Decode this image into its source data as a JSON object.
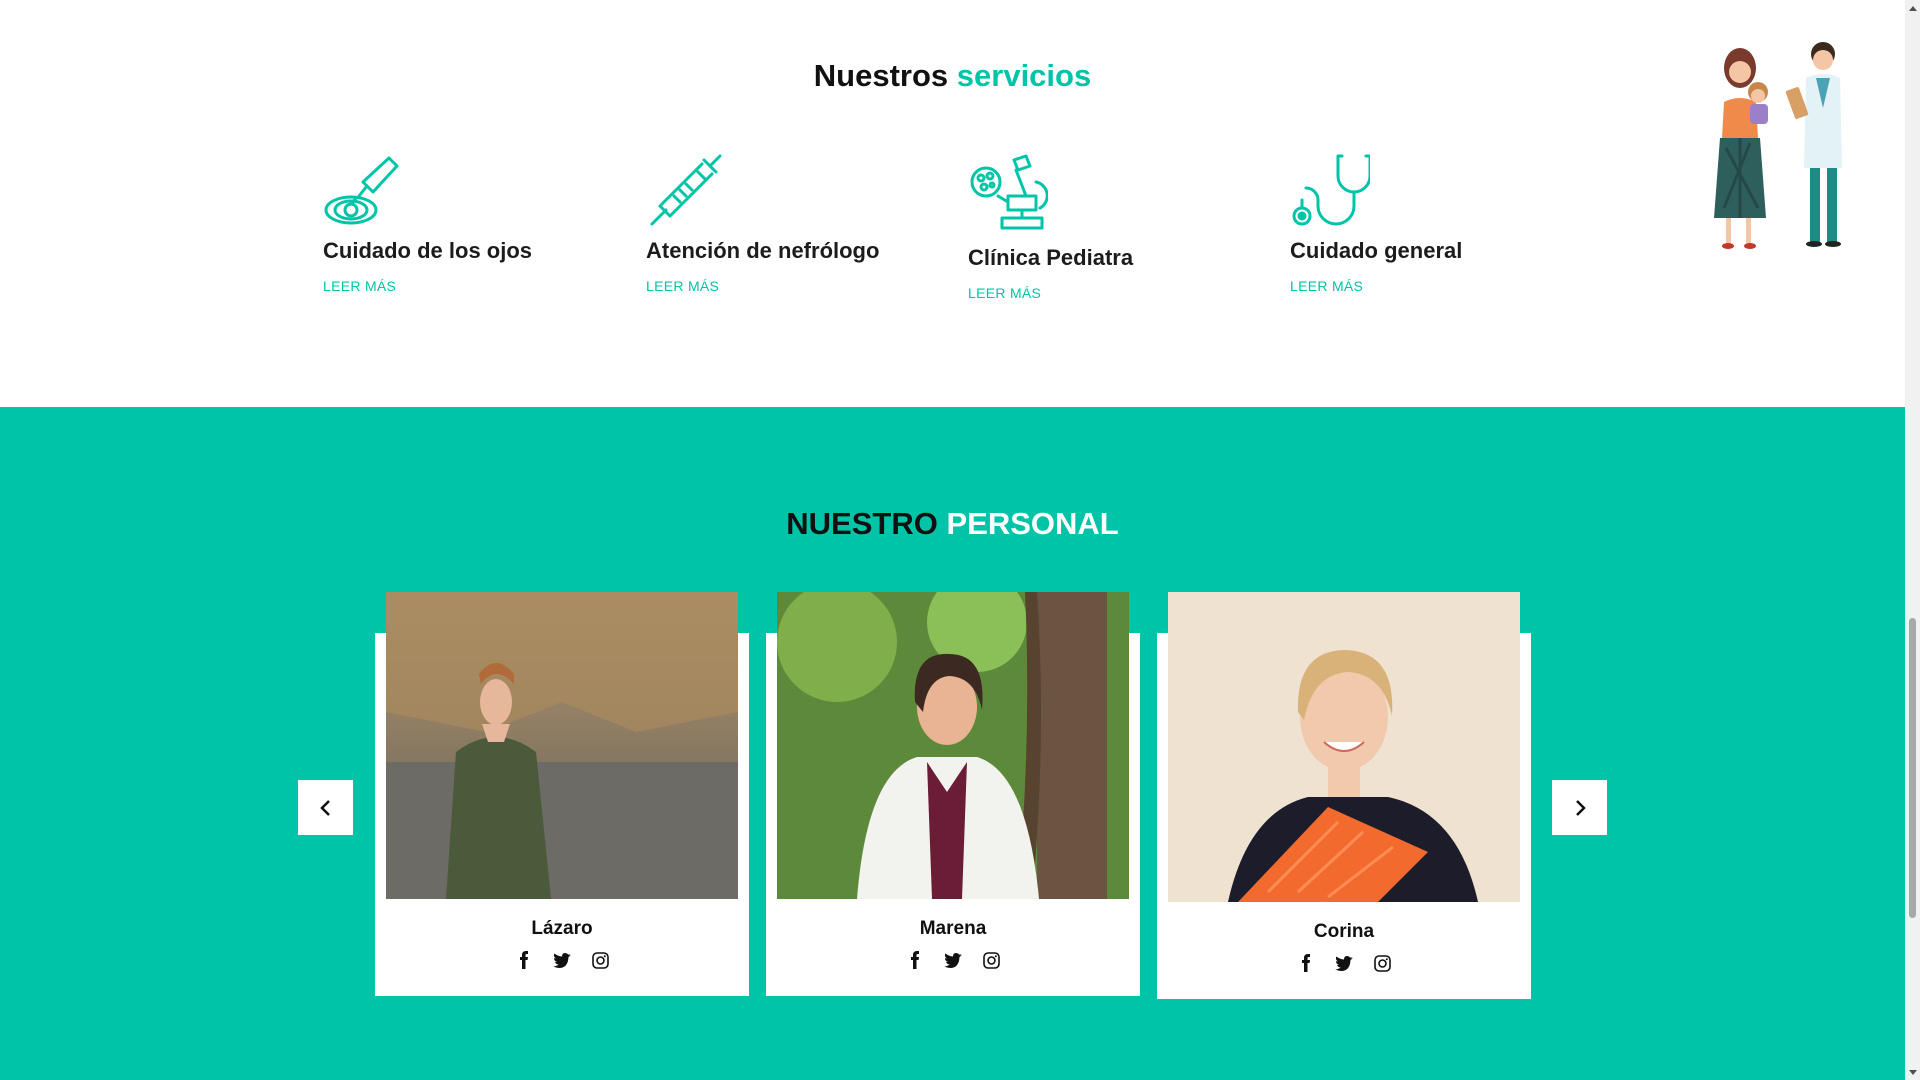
{
  "services": {
    "title_main": "Nuestros",
    "title_accent": "servicios",
    "items": [
      {
        "title": "Cuidado de los ojos",
        "link": "LEER MÁS",
        "icon": "eye-dropper-icon"
      },
      {
        "title": "Atención de nefrólogo",
        "link": "LEER MÁS",
        "icon": "syringe-icon"
      },
      {
        "title": "Clínica Pediatra",
        "link": "LEER MÁS",
        "icon": "microscope-icon"
      },
      {
        "title": "Cuidado general",
        "link": "LEER MÁS",
        "icon": "stethoscope-icon"
      }
    ]
  },
  "staff": {
    "title_main": "NUESTRO",
    "title_accent": "PERSONAL",
    "members": [
      {
        "name": "Lázaro"
      },
      {
        "name": "Marena"
      },
      {
        "name": "Corina"
      }
    ],
    "social_icons": [
      "facebook-icon",
      "twitter-icon",
      "instagram-icon"
    ]
  },
  "colors": {
    "accent": "#00c4a7",
    "heading": "#111111",
    "card": "#ffffff"
  }
}
